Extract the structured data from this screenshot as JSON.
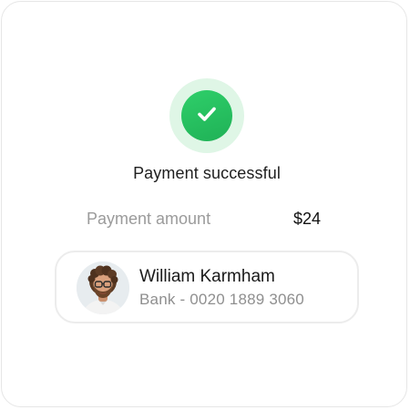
{
  "status": {
    "icon": "check-icon",
    "title": "Payment successful",
    "accent_color": "#22c55e"
  },
  "payment": {
    "amount_label": "Payment amount",
    "amount_value": "$24"
  },
  "recipient": {
    "avatar": "user-avatar",
    "name": "William Karmham",
    "bank": "Bank - 0020 1889 3060"
  }
}
